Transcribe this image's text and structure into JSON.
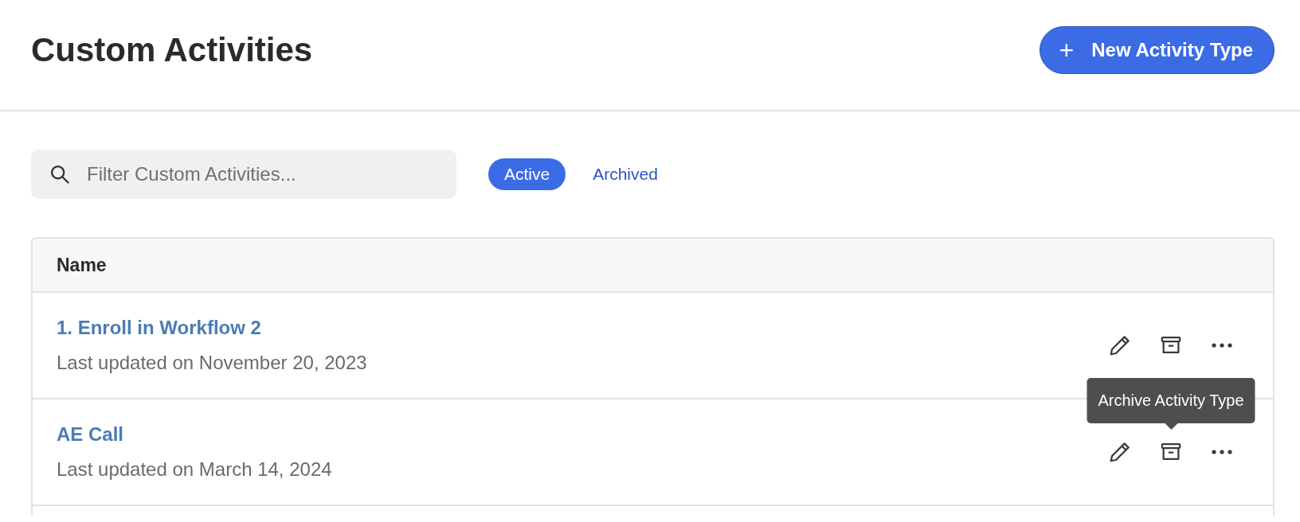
{
  "header": {
    "title": "Custom Activities",
    "new_button": {
      "icon": "+",
      "label": "New Activity Type"
    }
  },
  "search": {
    "placeholder": "Filter Custom Activities..."
  },
  "tabs": [
    {
      "label": "Active",
      "selected": true
    },
    {
      "label": "Archived",
      "selected": false
    }
  ],
  "table": {
    "columns": [
      "Name"
    ],
    "rows": [
      {
        "name": "1. Enroll in Workflow 2",
        "updated": "Last updated on November 20, 2023"
      },
      {
        "name": "AE Call",
        "updated": "Last updated on March 14, 2024",
        "tooltip": "Archive Activity Type"
      }
    ]
  }
}
